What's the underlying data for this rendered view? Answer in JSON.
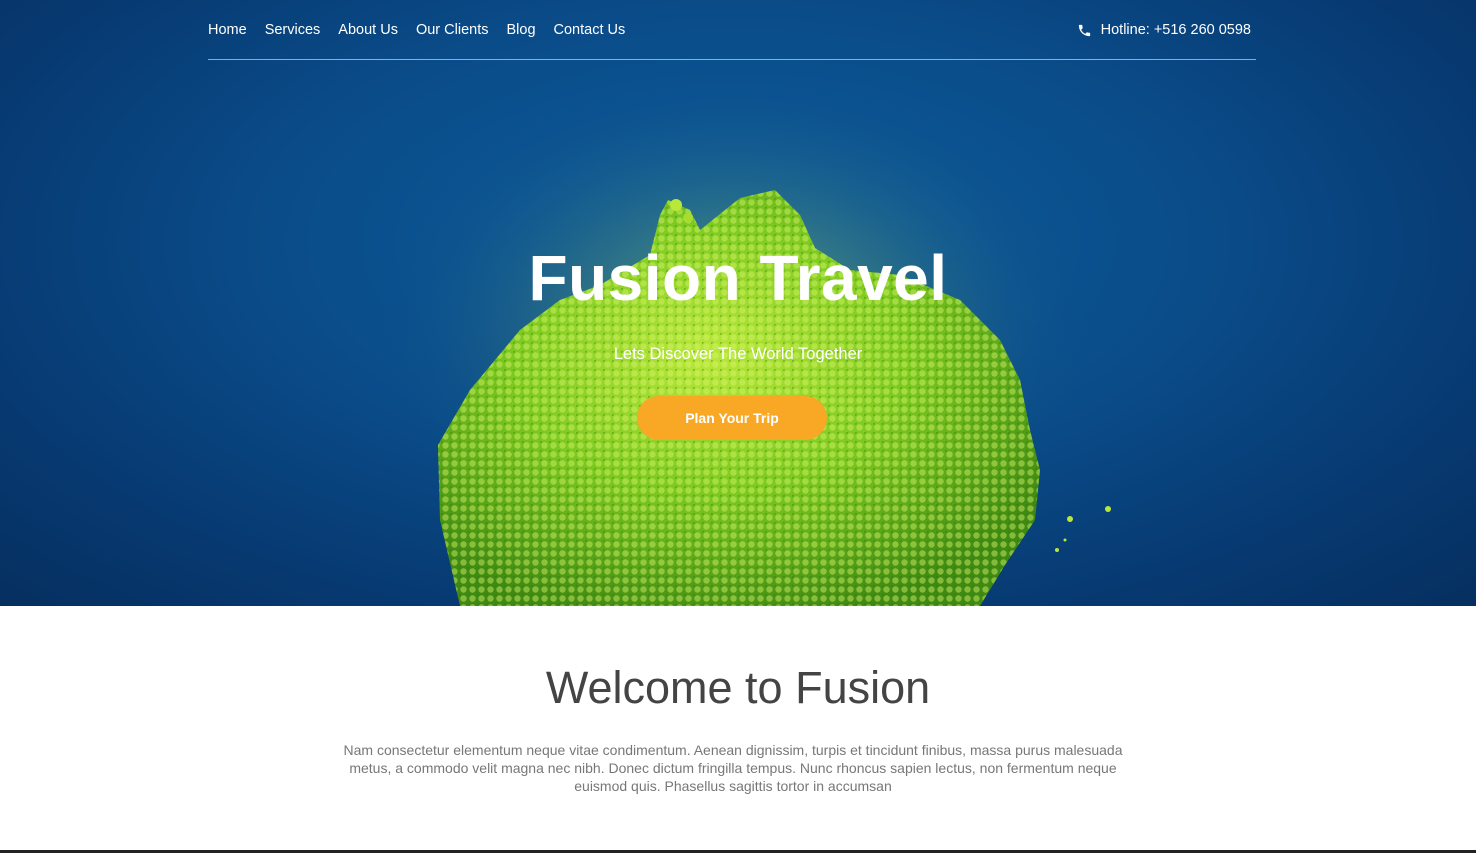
{
  "nav": {
    "links": [
      "Home",
      "Services",
      "About Us",
      "Our Clients",
      "Blog",
      "Contact Us"
    ],
    "hotline": "Hotline: +516 260 0598"
  },
  "hero": {
    "title": "Fusion Travel",
    "subtitle": "Lets Discover The World Together",
    "cta_label": "Plan Your Trip"
  },
  "welcome": {
    "title": "Welcome to Fusion",
    "text": "Nam consectetur elementum neque vitae condimentum. Aenean dignissim, turpis et tincidunt finibus, massa purus malesuada metus, a commodo velit magna nec nibh. Donec dictum fringilla tempus. Nunc rhoncus sapien lectus, non fermentum neque euismod quis. Phasellus sagittis tortor in accumsan"
  },
  "colors": {
    "hero_blue": "#0a4c89",
    "accent_orange": "#f9a825",
    "heading_gray": "#444444",
    "body_gray": "#777777"
  },
  "icons": {
    "hotline": "phone-icon"
  }
}
